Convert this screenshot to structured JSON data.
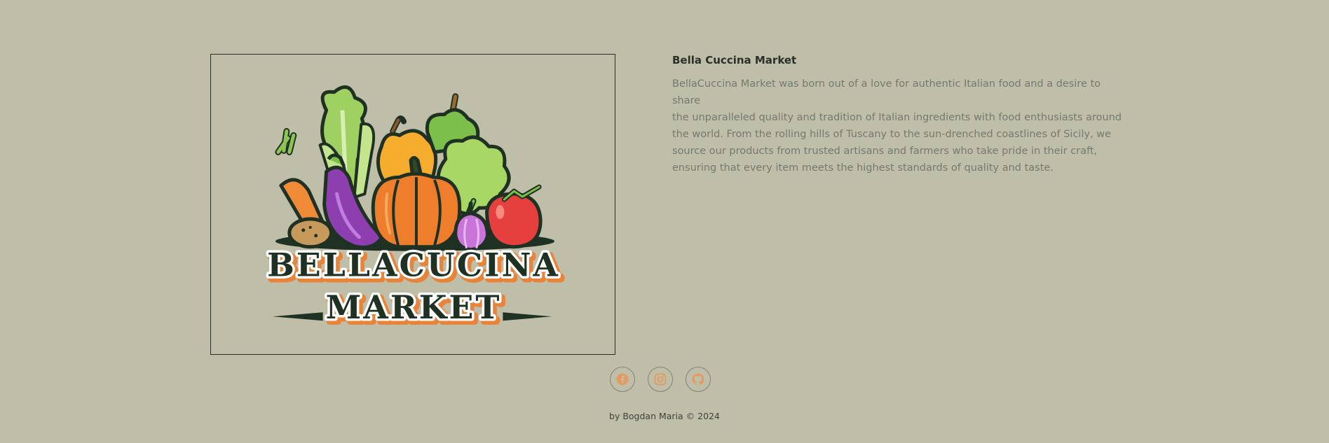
{
  "brand": {
    "logo_line1": "BELLACUCINA",
    "logo_line2": "MARKET"
  },
  "about": {
    "title": "Bella Cuccina Market",
    "text": "BellaCuccina Market was born out of a love for authentic Italian food and a desire to share\nthe unparalleled quality and tradition of Italian ingredients with food enthusiasts around\nthe world. From the rolling hills of Tuscany to the sun-drenched coastlines of Sicily, we\nsource our products from trusted artisans and farmers who take pride in their craft,\nensuring that every item meets the highest standards of quality and taste."
  },
  "social": {
    "items": [
      {
        "icon": "facebook-icon"
      },
      {
        "icon": "instagram-icon"
      },
      {
        "icon": "github-icon"
      }
    ]
  },
  "footer": {
    "credit": "by Bogdan Maria © 2024"
  },
  "colors": {
    "background": "#bfbea8",
    "dark_green": "#1f3122",
    "accent_orange": "#e8843a",
    "muted_text": "#747a6d",
    "icon_orange": "#e59a5e"
  }
}
